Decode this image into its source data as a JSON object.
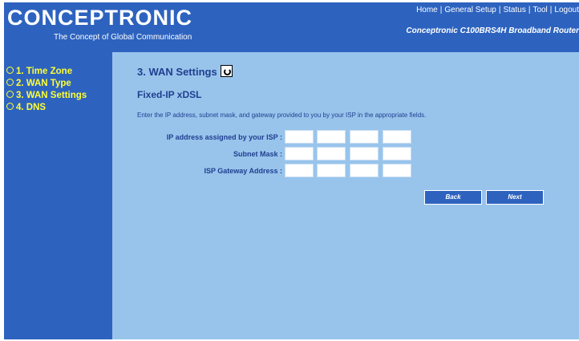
{
  "header": {
    "logo": "CONCEPTRONIC",
    "tagline": "The Concept of Global Communication",
    "nav": [
      "Home",
      "General Setup",
      "Status",
      "Tool",
      "Logout"
    ],
    "model": "Conceptronic C100BRS4H Broadband Router"
  },
  "sidebar": {
    "items": [
      {
        "label": "1. Time Zone"
      },
      {
        "label": "2. WAN Type"
      },
      {
        "label": "3. WAN Settings"
      },
      {
        "label": "4. DNS"
      }
    ]
  },
  "main": {
    "title": "3. WAN Settings",
    "subtitle": "Fixed-IP xDSL",
    "description": "Enter the IP address, subnet mask, and gateway provided to you by your ISP in the appropriate fields.",
    "fields": [
      {
        "label": "IP address assigned by your ISP :",
        "values": [
          "",
          "",
          "",
          ""
        ]
      },
      {
        "label": "Subnet Mask :",
        "values": [
          "",
          "",
          "",
          ""
        ]
      },
      {
        "label": "ISP Gateway Address :",
        "values": [
          "",
          "",
          "",
          ""
        ]
      }
    ],
    "buttons": {
      "back": "Back",
      "next": "Next"
    }
  },
  "colors": {
    "header_bg": "#2d63bf",
    "main_bg": "#98c4ec",
    "sidebar_text": "#ffff33",
    "main_text": "#1f3f8f"
  }
}
